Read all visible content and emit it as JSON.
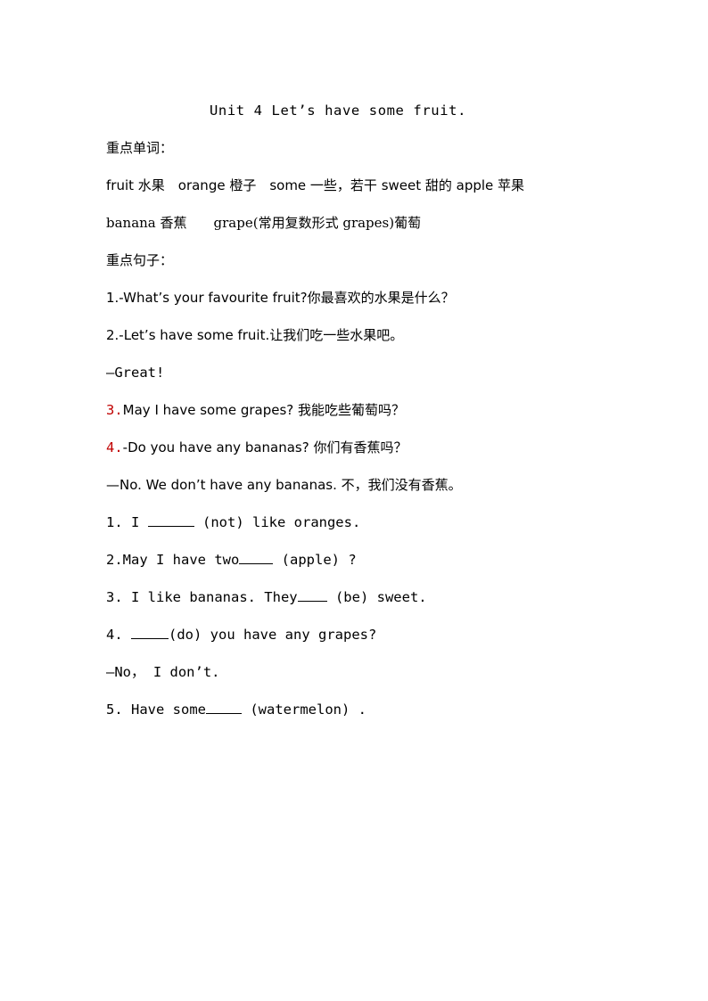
{
  "document": {
    "title": "Unit 4 Let’s have some fruit.",
    "page_background": "#ffffff",
    "text_color": "#000000",
    "accent_color": "#C00000"
  },
  "sections": {
    "vocab_heading": "重点单词：",
    "vocab_line_1": "fruit 水果　orange 橙子　some 一些，若干 sweet 甜的 apple 苹果",
    "vocab_line_2": "banana 香蕉　　grape(常用复数形式 grapes)葡萄",
    "sentences_heading": "重点句子：",
    "sentence_1": "1.-What’s your favourite fruit?你最喜欢的水果是什么？",
    "sentence_2": "2.-Let’s have some fruit.让我们吃一些水果吧。",
    "sentence_2_reply": "—Great!",
    "sentence_3_marker": "3.",
    "sentence_3_text": "May I have some grapes? 我能吃些葡萄吗？",
    "sentence_4_marker": "4.",
    "sentence_4_text": "-Do you have any bananas? 你们有香蕉吗？",
    "sentence_4_reply": "—No. We don’t have any bananas. 不，我们没有香蕉。"
  },
  "exercises": [
    {
      "number": "1.",
      "before": " I ",
      "blank": true,
      "after": " (not) like oranges."
    },
    {
      "number": "2.",
      "before": "May I have two",
      "blank": true,
      "after": " (apple) ?"
    },
    {
      "number": "3.",
      "before": " I like bananas. They",
      "blank": true,
      "after": " (be) sweet."
    },
    {
      "number": "4.",
      "before": " ",
      "blank": true,
      "after": "(do) you have any grapes?"
    },
    {
      "number": "",
      "before": "—No， I don’t.",
      "blank": false,
      "after": ""
    },
    {
      "number": "5.",
      "before": " Have some",
      "blank": true,
      "after": " (watermelon) ."
    }
  ],
  "exercise_lines": {
    "ex1_num": "1.",
    "ex1_pre": " I ",
    "ex1_post": " (not) like oranges.",
    "ex2_num": "2.",
    "ex2_pre": "May I have two",
    "ex2_post": " (apple) ?",
    "ex3_num": "3.",
    "ex3_pre": " I like bananas. They",
    "ex3_post": " (be) sweet.",
    "ex4_num": "4.",
    "ex4_pre": " ",
    "ex4_post": "(do) you have any grapes?",
    "ex4_reply": "—No， I don’t.",
    "ex5_num": "5.",
    "ex5_pre": " Have some",
    "ex5_post": " (watermelon) ."
  }
}
